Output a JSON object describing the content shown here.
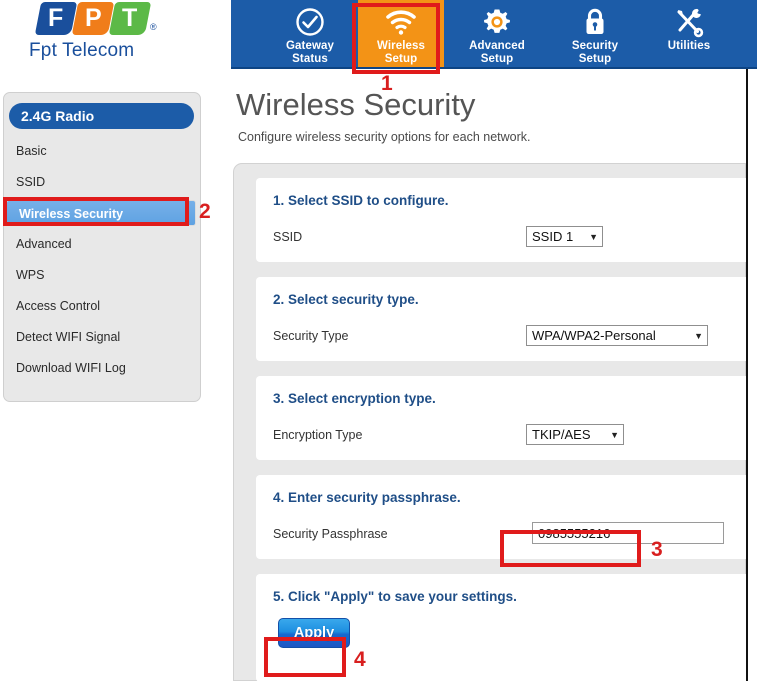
{
  "brand": {
    "logo_letters": [
      "F",
      "P",
      "T"
    ],
    "registered_mark": "®",
    "name": "Fpt Telecom",
    "colors": {
      "blue": "#1a4f9c",
      "orange": "#f07d1a",
      "green": "#5cb947"
    }
  },
  "nav": {
    "active_color": "#f39316",
    "bar_color": "#1c5ca8",
    "items": [
      {
        "label": "Gateway\nStatus",
        "icon": "check-circle-icon",
        "active": false
      },
      {
        "label": "Wireless\nSetup",
        "icon": "wifi-icon",
        "active": true
      },
      {
        "label": "Advanced\nSetup",
        "icon": "gear-icon",
        "active": false
      },
      {
        "label": "Security\nSetup",
        "icon": "lock-icon",
        "active": false
      },
      {
        "label": "Utilities",
        "icon": "tools-icon",
        "active": false
      }
    ]
  },
  "sidebar": {
    "heading": "2.4G Radio",
    "items": [
      {
        "label": "Basic",
        "selected": false
      },
      {
        "label": "SSID",
        "selected": false
      },
      {
        "label": "Wireless Security",
        "selected": true
      },
      {
        "label": "Advanced",
        "selected": false
      },
      {
        "label": "WPS",
        "selected": false
      },
      {
        "label": "Access Control",
        "selected": false
      },
      {
        "label": "Detect WIFI Signal",
        "selected": false
      },
      {
        "label": "Download WIFI Log",
        "selected": false
      }
    ]
  },
  "main": {
    "title": "Wireless Security",
    "subtitle": "Configure wireless security options for each network.",
    "sections": {
      "ssid": {
        "heading": "1. Select SSID to configure.",
        "label": "SSID",
        "value": "SSID 1",
        "caret": "▼"
      },
      "security_type": {
        "heading": "2. Select security type.",
        "label": "Security Type",
        "value": "WPA/WPA2-Personal",
        "caret": "▼"
      },
      "encryption_type": {
        "heading": "3. Select encryption type.",
        "label": "Encryption Type",
        "value": "TKIP/AES",
        "caret": "▼"
      },
      "passphrase": {
        "heading": "4. Enter security passphrase.",
        "label": "Security Passphrase",
        "value": "0985555216",
        "placeholder": ""
      },
      "apply": {
        "heading": "5. Click \"Apply\" to save your settings.",
        "button_label": "Apply"
      }
    }
  },
  "annotations": {
    "color": "#d81f1f",
    "steps": [
      "1",
      "2",
      "3",
      "4"
    ]
  }
}
